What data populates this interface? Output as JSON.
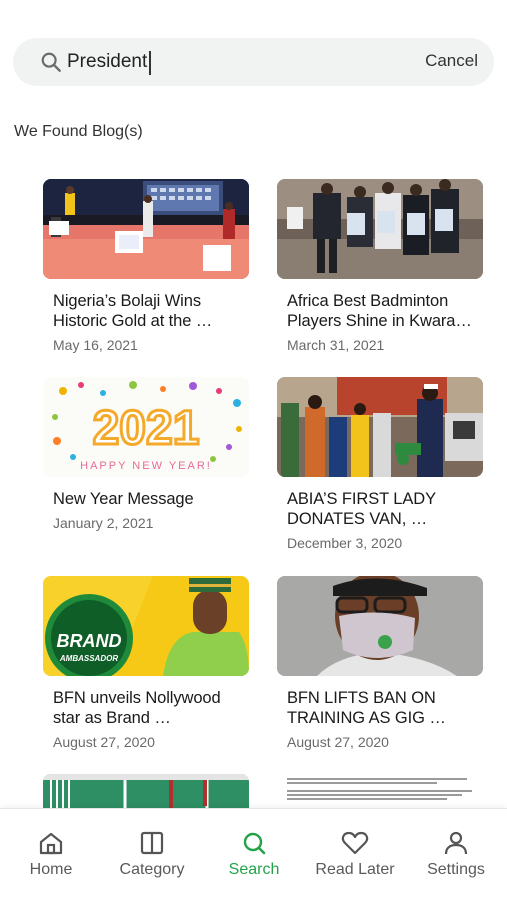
{
  "search": {
    "value": "President",
    "cancel_label": "Cancel"
  },
  "results_heading": "We Found Blog(s)",
  "posts": [
    {
      "title": "Nigeria’s Bolaji Wins Historic Gold at the …",
      "date": "May 16, 2021"
    },
    {
      "title": "Africa Best Badminton Players Shine in Kwara…",
      "date": "March 31, 2021"
    },
    {
      "title": "New Year Message",
      "date": "January 2, 2021"
    },
    {
      "title": "ABIA’S FIRST LADY DONATES VAN, …",
      "date": "December 3, 2020"
    },
    {
      "title": "BFN unveils Nollywood star as Brand …",
      "date": "August 27, 2020"
    },
    {
      "title": "BFN LIFTS BAN ON TRAINING AS GIG …",
      "date": "August 27, 2020"
    },
    {
      "title": "",
      "date": ""
    },
    {
      "title": "",
      "date": ""
    }
  ],
  "thumb_text": {
    "year": "2021",
    "greeting": "HAPPY NEW YEAR!",
    "brand": "BRAND",
    "ambassador": "AMBASSADOR"
  },
  "nav": {
    "items": [
      {
        "label": "Home",
        "icon": "home-icon"
      },
      {
        "label": "Category",
        "icon": "category-icon"
      },
      {
        "label": "Search",
        "icon": "search-icon"
      },
      {
        "label": "Read Later",
        "icon": "heart-icon"
      },
      {
        "label": "Settings",
        "icon": "person-icon"
      }
    ],
    "active": "Search"
  },
  "colors": {
    "accent": "#22a34a",
    "search_bg": "#f1f2f2",
    "text": "#1a1a1a",
    "muted": "#6a6a6a"
  }
}
